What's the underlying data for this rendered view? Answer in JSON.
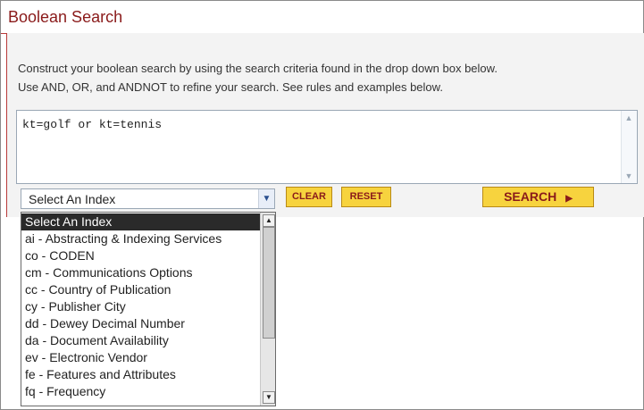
{
  "panel_title": "Boolean Search",
  "instructions": {
    "line1": "Construct your boolean search by using the search criteria found in the drop down box below.",
    "line2": "Use AND, OR, and ANDNOT to refine your search. See rules and examples below."
  },
  "query": {
    "value": "kt=golf or kt=tennis"
  },
  "index_select": {
    "selected": "Select An Index"
  },
  "buttons": {
    "clear": "CLEAR",
    "reset": "RESET",
    "search": "SEARCH"
  },
  "dropdown_options": [
    "Select An Index",
    "ai - Abstracting & Indexing Services",
    "co - CODEN",
    "cm - Communications Options",
    "cc - Country of Publication",
    "cy - Publisher City",
    "dd - Dewey Decimal Number",
    "da - Document Availability",
    "ev - Electronic Vendor",
    "fe - Features and Attributes",
    "fq - Frequency"
  ],
  "colors": {
    "title": "#8a1a1a",
    "accent_border": "#b83a3a",
    "button_fill": "#f7d33e",
    "button_text": "#8a1a1a"
  },
  "icons": {
    "select_arrow": "chevron-down-icon",
    "search_arrow": "triangle-right-icon"
  }
}
